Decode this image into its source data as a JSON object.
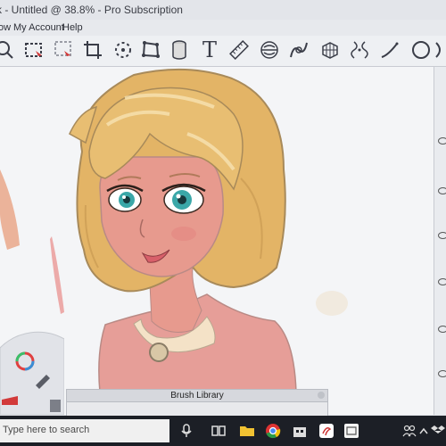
{
  "window": {
    "title": "k - Untitled @ 38.8% - Pro Subscription"
  },
  "menu": {
    "items": [
      "ow",
      "My Account",
      "Help"
    ]
  },
  "toolbar": {
    "tools": [
      "zoom",
      "rect-select",
      "marquee-select",
      "crop",
      "transform",
      "perspective",
      "cylinder",
      "text",
      "ruler",
      "symmetry",
      "curve",
      "grid",
      "fill",
      "stroke",
      "ellipse"
    ]
  },
  "brush_library": {
    "title": "Brush Library"
  },
  "taskbar": {
    "search_placeholder": "Type here to search"
  },
  "colors": {
    "accent": "#3a8fd6",
    "taskbar": "#1c1f26",
    "skin": "#e79a8e",
    "hair": "#e3b466"
  }
}
